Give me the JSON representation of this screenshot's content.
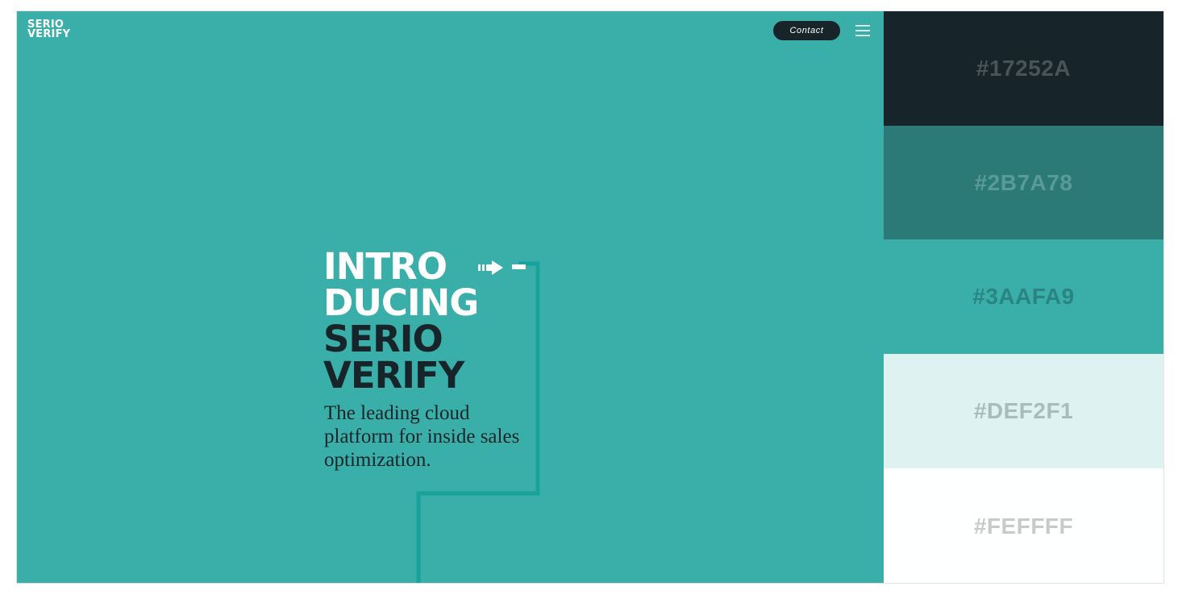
{
  "logo": {
    "line1": "SERIO",
    "line2": "VERIFY"
  },
  "nav": {
    "contact_label": "Contact"
  },
  "hero": {
    "headline_line1": "INTRO",
    "headline_line2": "DUCING",
    "headline_line3": "SERIO",
    "headline_line4": "VERIFY",
    "tagline": "The leading cloud platform for inside sales optimization."
  },
  "colors": {
    "accent": "#3AAFA9",
    "dark": "#17252A",
    "mid": "#2B7A78",
    "light": "#DEF2F1",
    "white": "#FEFFFF"
  },
  "palette": [
    {
      "hex": "#17252A",
      "label_color": "#4a5357"
    },
    {
      "hex": "#2B7A78",
      "label_color": "#5a9a98"
    },
    {
      "hex": "#3AAFA9",
      "label_color": "#2b8480"
    },
    {
      "hex": "#DEF2F1",
      "label_color": "#a9bcbb"
    },
    {
      "hex": "#FEFFFF",
      "label_color": "#c9c9c9"
    }
  ]
}
